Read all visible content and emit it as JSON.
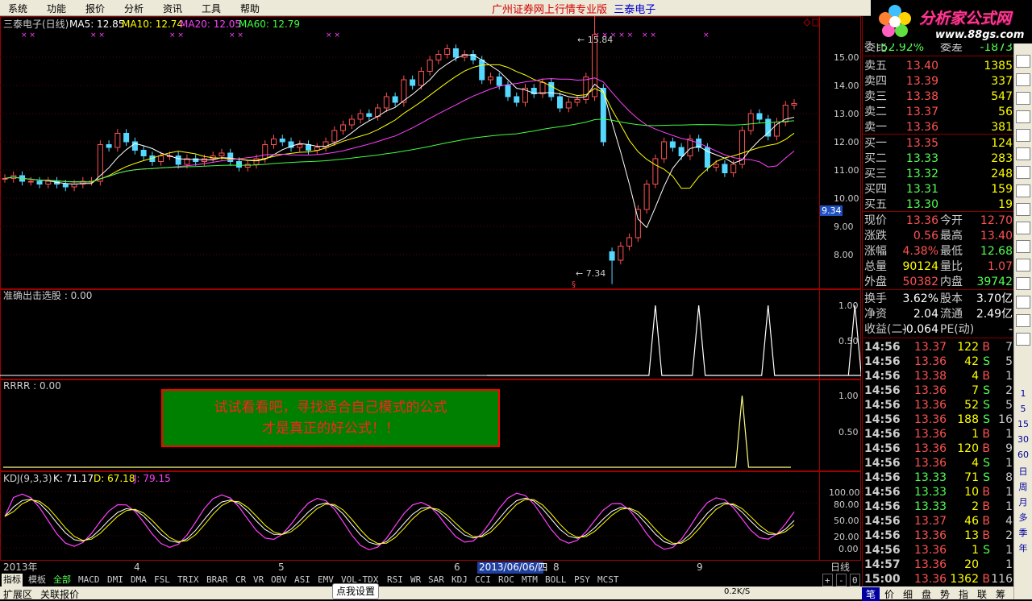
{
  "menu": [
    "系统",
    "功能",
    "报价",
    "分析",
    "资讯",
    "工具",
    "帮助"
  ],
  "app_title": "广州证券网上行情专业版",
  "stock_title": "三泰电子",
  "logo": {
    "text": "分析家公式网",
    "url": "www.88gs.com"
  },
  "chart_header": {
    "name": "三泰电子(日线)",
    "ma5": "MA5: 12.85",
    "ma10": "MA10: 12.74",
    "ma20": "MA20: 12.05",
    "ma60": "MA60: 12.79"
  },
  "price_axis": [
    "15.00",
    "14.00",
    "13.00",
    "12.00",
    "11.00",
    "10.00",
    "9.00",
    "8.00"
  ],
  "current_price_tag": "9.34",
  "max_label": "15.84",
  "min_label": "7.34",
  "panel2_title": "准确出击选股 : 0.00",
  "panel2_axis": [
    "1.00",
    "0.50"
  ],
  "panel3_title": "RRRR : 0.00",
  "panel3_axis": [
    "1.00",
    "0.50"
  ],
  "promo": {
    "line1": "试试看看吧，寻找适合自己模式的公式",
    "line2": "才是真正的好公式！！"
  },
  "kdj": {
    "name": "KDJ(9,3,3)",
    "k": "K: 71.17",
    "d": "D: 67.18",
    "j": "J: 79.15"
  },
  "kdj_axis": [
    "100.00",
    "80.00",
    "50.00",
    "20.00",
    "0.00"
  ],
  "date_axis": [
    "2013年",
    "4",
    "5",
    "6",
    "2013/06/06/四",
    "8",
    "9"
  ],
  "period_label": "日线",
  "bottom_tabs": [
    "指标",
    "模板",
    "全部",
    "MACD",
    "DMI",
    "DMA",
    "FSL",
    "TRIX",
    "BRAR",
    "CR",
    "VR",
    "OBV",
    "ASI",
    "EMV",
    "VOL-TDX",
    "RSI",
    "WR",
    "SAR",
    "KDJ",
    "CCI",
    "ROC",
    "MTM",
    "BOLL",
    "PSY",
    "MCST"
  ],
  "bottom_ctrl": [
    "+",
    "-",
    "0"
  ],
  "status": {
    "expand": "扩展区",
    "linked": "关联报价",
    "set_button": "点我设置",
    "vol_hint": "0.2K/S"
  },
  "quote": {
    "wei_bi_label": "委比",
    "wei_bi": "-52.92%",
    "wei_cha_label": "委差",
    "wei_cha": "-1873",
    "asks": [
      {
        "l": "卖五",
        "p": "13.40",
        "v": "1385"
      },
      {
        "l": "卖四",
        "p": "13.39",
        "v": "337"
      },
      {
        "l": "卖三",
        "p": "13.38",
        "v": "547"
      },
      {
        "l": "卖二",
        "p": "13.37",
        "v": "56"
      },
      {
        "l": "卖一",
        "p": "13.36",
        "v": "381"
      }
    ],
    "bids": [
      {
        "l": "买一",
        "p": "13.35",
        "v": "124"
      },
      {
        "l": "买二",
        "p": "13.33",
        "v": "283"
      },
      {
        "l": "买三",
        "p": "13.32",
        "v": "248"
      },
      {
        "l": "买四",
        "p": "13.31",
        "v": "159"
      },
      {
        "l": "买五",
        "p": "13.30",
        "v": "19"
      }
    ],
    "stats": [
      {
        "a": "现价",
        "av": "13.36",
        "b": "今开",
        "bv": "12.70"
      },
      {
        "a": "涨跌",
        "av": "0.56",
        "b": "最高",
        "bv": "13.40"
      },
      {
        "a": "涨幅",
        "av": "4.38%",
        "b": "最低",
        "bv": "12.68"
      },
      {
        "a": "总量",
        "av": "90124",
        "b": "量比",
        "bv": "1.07"
      },
      {
        "a": "外盘",
        "av": "50382",
        "b": "内盘",
        "bv": "39742"
      }
    ],
    "stats2": [
      {
        "a": "换手",
        "av": "3.62%",
        "b": "股本",
        "bv": "3.70亿"
      },
      {
        "a": "净资",
        "av": "2.04",
        "b": "流通",
        "bv": "2.49亿"
      },
      {
        "a": "收益(二)",
        "av": "-0.064",
        "b": "PE(动)",
        "bv": "-"
      }
    ]
  },
  "ticks": [
    {
      "t": "14:56",
      "p": "13.37",
      "v": "122",
      "s": "B",
      "n": "7"
    },
    {
      "t": "14:56",
      "p": "13.36",
      "v": "42",
      "s": "S",
      "n": "5"
    },
    {
      "t": "14:56",
      "p": "13.38",
      "v": "4",
      "s": "B",
      "n": "1"
    },
    {
      "t": "14:56",
      "p": "13.36",
      "v": "7",
      "s": "S",
      "n": "2"
    },
    {
      "t": "14:56",
      "p": "13.36",
      "v": "52",
      "s": "S",
      "n": "5"
    },
    {
      "t": "14:56",
      "p": "13.36",
      "v": "188",
      "s": "S",
      "n": "16"
    },
    {
      "t": "14:56",
      "p": "13.36",
      "v": "1",
      "s": "B",
      "n": "1"
    },
    {
      "t": "14:56",
      "p": "13.36",
      "v": "120",
      "s": "B",
      "n": "9"
    },
    {
      "t": "14:56",
      "p": "13.36",
      "v": "4",
      "s": "S",
      "n": "1"
    },
    {
      "t": "14:56",
      "p": "13.33",
      "v": "71",
      "s": "S",
      "n": "8"
    },
    {
      "t": "14:56",
      "p": "13.33",
      "v": "10",
      "s": "B",
      "n": "1"
    },
    {
      "t": "14:56",
      "p": "13.33",
      "v": "2",
      "s": "B",
      "n": "1"
    },
    {
      "t": "14:56",
      "p": "13.37",
      "v": "46",
      "s": "B",
      "n": "4"
    },
    {
      "t": "14:56",
      "p": "13.36",
      "v": "13",
      "s": "B",
      "n": "2"
    },
    {
      "t": "14:56",
      "p": "13.36",
      "v": "1",
      "s": "S",
      "n": "1"
    },
    {
      "t": "14:57",
      "p": "13.36",
      "v": "20",
      "s": "",
      "n": "1"
    },
    {
      "t": "15:00",
      "p": "13.36",
      "v": "1362",
      "s": "B",
      "n": "116"
    }
  ],
  "right_tabs": [
    "笔",
    "价",
    "细",
    "盘",
    "势",
    "指",
    "联",
    "筹"
  ],
  "side_icons": [
    "1",
    "5",
    "15",
    "30",
    "60",
    "日",
    "周",
    "月",
    "多",
    "季",
    "年"
  ],
  "chart_data": [
    {
      "type": "candlestick",
      "title": "三泰电子(日线)",
      "ylim": [
        7.0,
        16.2
      ],
      "series": [
        {
          "name": "MA5",
          "value": 12.85
        },
        {
          "name": "MA10",
          "value": 12.74
        },
        {
          "name": "MA20",
          "value": 12.05
        },
        {
          "name": "MA60",
          "value": 12.79
        }
      ],
      "high": 15.84,
      "low": 7.34,
      "last": 13.36,
      "closes": [
        10.7,
        10.8,
        10.6,
        10.6,
        10.5,
        10.6,
        10.5,
        10.4,
        10.5,
        10.6,
        10.6,
        11.9,
        11.8,
        12.3,
        12.0,
        11.7,
        11.5,
        11.3,
        11.5,
        11.5,
        11.2,
        11.4,
        11.3,
        11.4,
        11.5,
        11.6,
        11.3,
        11.1,
        11.2,
        11.4,
        11.9,
        12.1,
        12.0,
        11.8,
        11.9,
        11.7,
        11.8,
        12.0,
        12.4,
        12.6,
        12.8,
        13.0,
        12.9,
        13.2,
        13.6,
        13.4,
        14.2,
        14.0,
        14.5,
        14.9,
        15.1,
        15.3,
        15.0,
        15.1,
        14.9,
        14.2,
        14.3,
        14.0,
        13.6,
        13.4,
        13.9,
        13.7,
        14.1,
        13.6,
        13.2,
        13.4,
        13.5,
        14.3,
        15.8,
        12.0,
        7.8,
        8.3,
        8.6,
        9.6,
        10.5,
        11.4,
        12.0,
        11.8,
        11.5,
        12.1,
        11.8,
        11.1,
        11.2,
        10.9,
        11.2,
        12.4,
        13.0,
        12.8,
        12.2,
        12.7,
        13.3,
        13.36
      ]
    },
    {
      "type": "line",
      "title": "准确出击选股",
      "ylim": [
        0,
        1.2
      ],
      "spike_index": [
        75,
        80,
        88,
        98,
        103
      ]
    },
    {
      "type": "line",
      "title": "RRRR",
      "ylim": [
        0,
        1.2
      ],
      "spike_index": [
        85
      ]
    },
    {
      "type": "line",
      "title": "KDJ(9,3,3)",
      "ylim": [
        0,
        110
      ],
      "series": [
        {
          "name": "K",
          "value": 71.17
        },
        {
          "name": "D",
          "value": 67.18
        },
        {
          "name": "J",
          "value": 79.15
        }
      ]
    }
  ]
}
